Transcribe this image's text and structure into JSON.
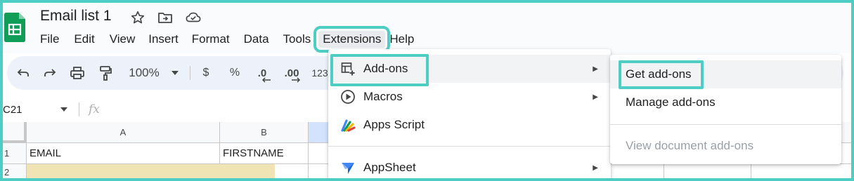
{
  "document": {
    "title": "Email list 1"
  },
  "menubar": {
    "items": [
      {
        "label": "File"
      },
      {
        "label": "Edit"
      },
      {
        "label": "View"
      },
      {
        "label": "Insert"
      },
      {
        "label": "Format"
      },
      {
        "label": "Data"
      },
      {
        "label": "Tools"
      },
      {
        "label": "Extensions"
      },
      {
        "label": "Help"
      }
    ]
  },
  "toolbar": {
    "zoom": "100%",
    "currency": "$",
    "percent": "%",
    "decrease_decimal": ".0",
    "increase_decimal": ".00",
    "number_format": "123"
  },
  "formula_bar": {
    "name_box": "C21",
    "fx": "fx"
  },
  "grid": {
    "columns": [
      "A",
      "B"
    ],
    "rows": [
      {
        "num": "1",
        "cells": [
          "EMAIL",
          "FIRSTNAME"
        ]
      },
      {
        "num": "2",
        "cells": [
          "",
          ""
        ]
      }
    ]
  },
  "extensions_menu": {
    "items": [
      {
        "label": "Add-ons",
        "icon": "add-ons-icon",
        "has_submenu": true
      },
      {
        "label": "Macros",
        "icon": "macros-icon",
        "has_submenu": true
      },
      {
        "label": "Apps Script",
        "icon": "apps-script-icon",
        "has_submenu": false
      },
      {
        "label": "AppSheet",
        "icon": "appsheet-icon",
        "has_submenu": true
      }
    ]
  },
  "addons_submenu": {
    "items": [
      {
        "label": "Get add-ons",
        "disabled": false
      },
      {
        "label": "Manage add-ons",
        "disabled": false
      },
      {
        "label": "View document add-ons",
        "disabled": true
      }
    ]
  },
  "colors": {
    "highlight": "#4ecdc4",
    "sheets_green": "#0f9d58",
    "toolbar_bg": "#edf2fa",
    "selected_cell": "#f0e3b4"
  }
}
